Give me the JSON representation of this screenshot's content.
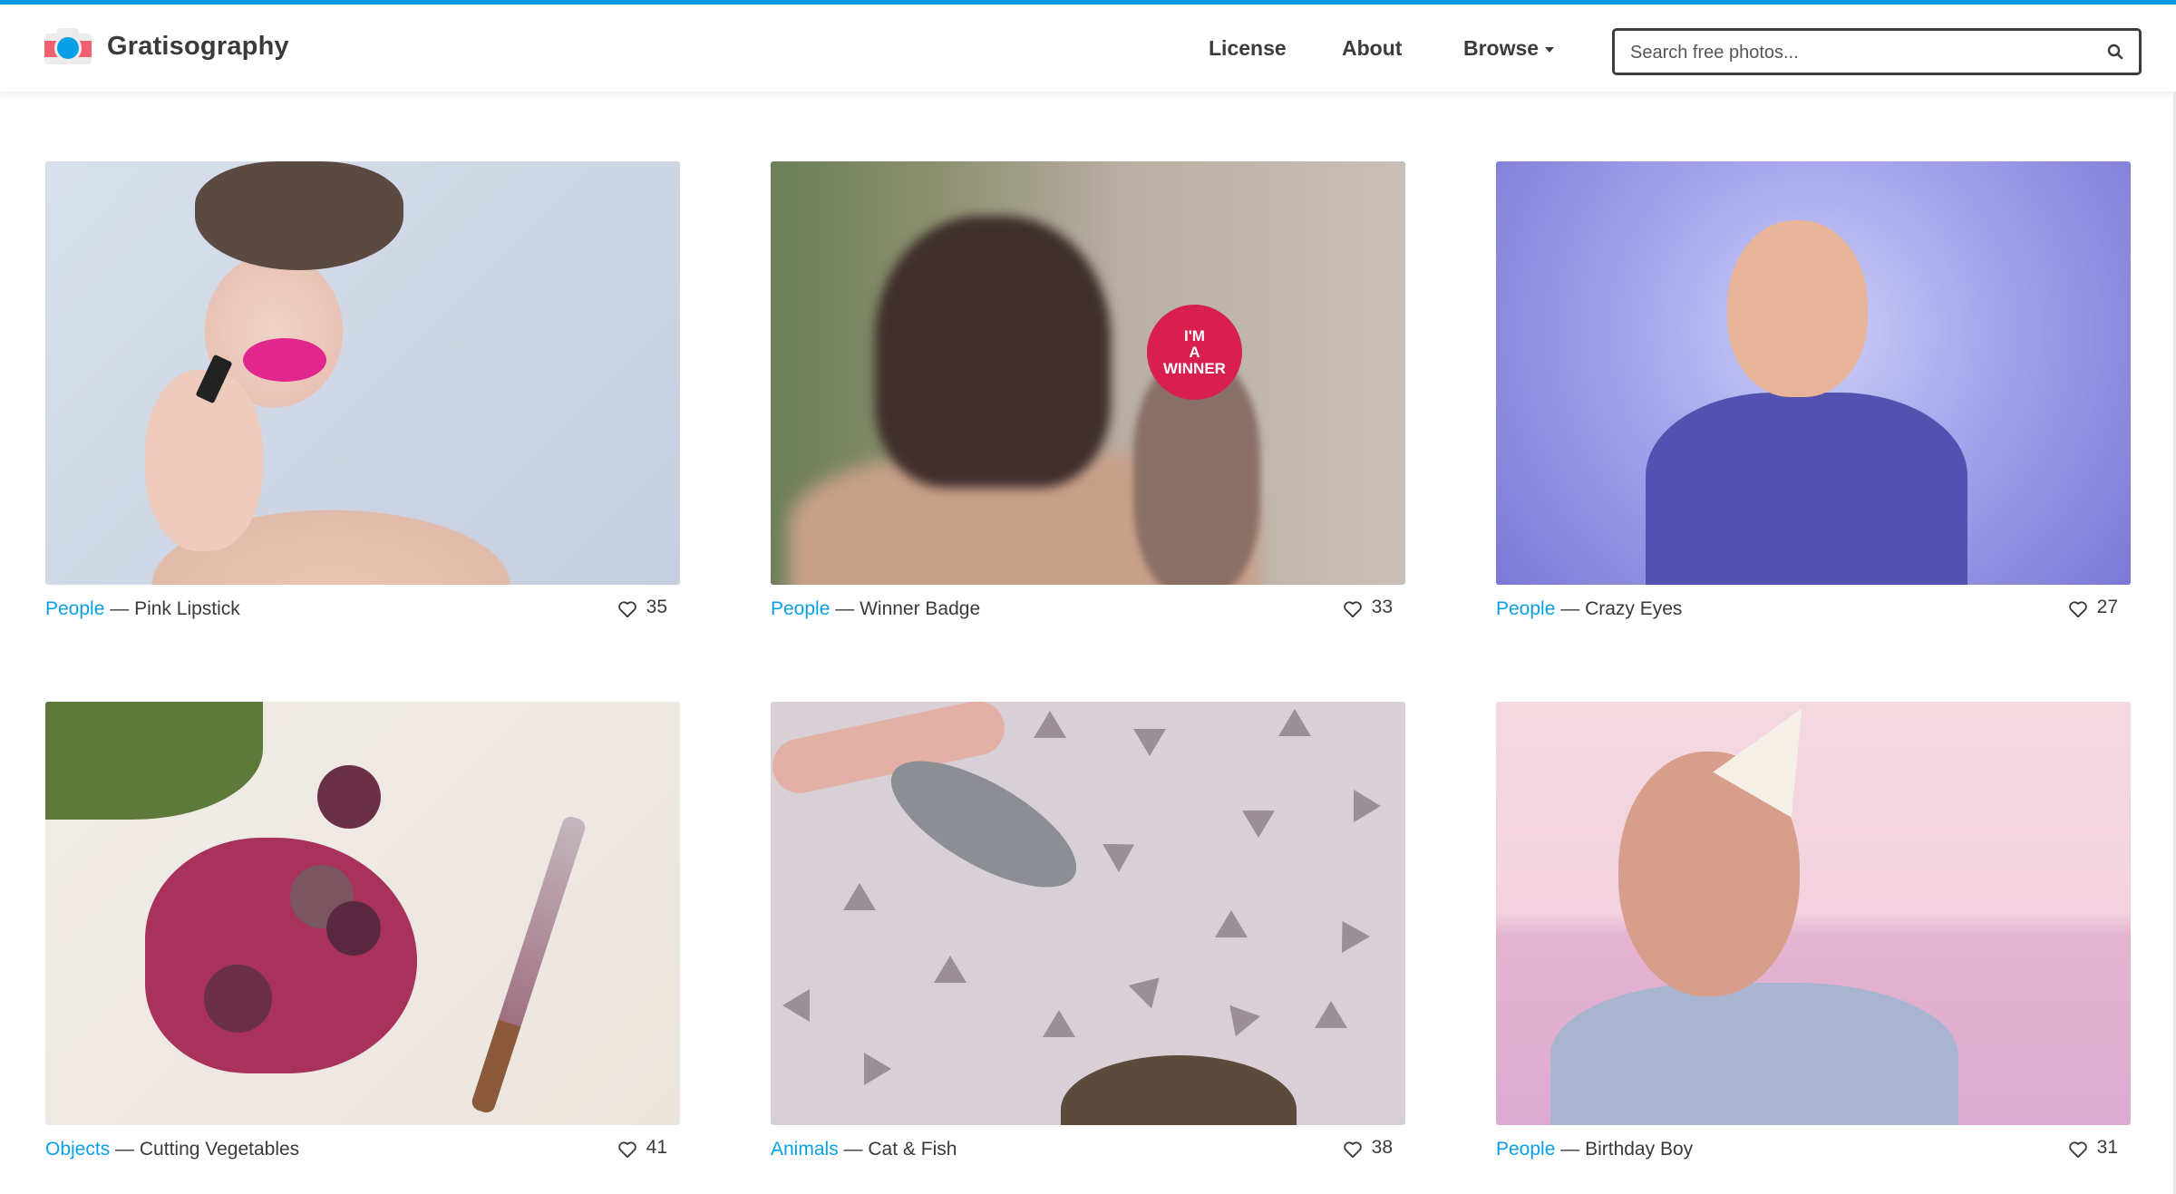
{
  "brand": {
    "name": "Gratisography",
    "accent_color": "#0a9ae0",
    "logo_icon": "camera-icon"
  },
  "nav": {
    "items": [
      {
        "label": "License"
      },
      {
        "label": "About"
      },
      {
        "label": "Browse",
        "has_dropdown": true
      }
    ]
  },
  "search": {
    "placeholder": "Search free photos...",
    "value": "",
    "icon": "search-icon"
  },
  "gallery": {
    "photos": [
      {
        "category": "People",
        "separator": "—",
        "title": "Pink Lipstick",
        "likes": "35"
      },
      {
        "category": "People",
        "separator": "—",
        "title": "Winner Badge",
        "likes": "33",
        "badge_text": "I'M A WINNER"
      },
      {
        "category": "People",
        "separator": "—",
        "title": "Crazy Eyes",
        "likes": "27"
      },
      {
        "category": "Objects",
        "separator": "—",
        "title": "Cutting Vegetables",
        "likes": "41"
      },
      {
        "category": "Animals",
        "separator": "—",
        "title": "Cat & Fish",
        "likes": "38"
      },
      {
        "category": "People",
        "separator": "—",
        "title": "Birthday Boy",
        "likes": "31"
      }
    ]
  }
}
